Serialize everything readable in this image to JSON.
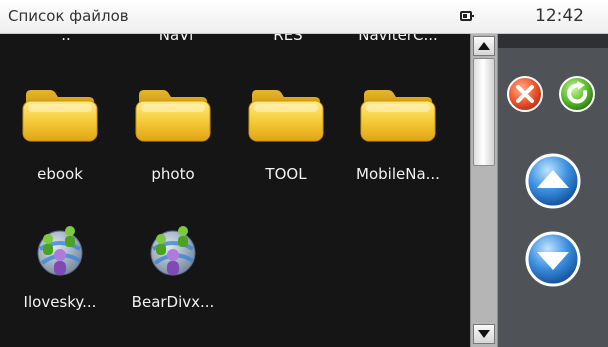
{
  "titlebar": {
    "title": "Список файлов",
    "battery_icon": "battery-icon",
    "time": "12:42"
  },
  "files": {
    "partial_row": [
      "..",
      "NaVi",
      "RES",
      "NaviterC..."
    ],
    "items": [
      {
        "label": "ebook",
        "icon": "folder-icon"
      },
      {
        "label": "photo",
        "icon": "folder-icon"
      },
      {
        "label": "TOOL",
        "icon": "folder-icon"
      },
      {
        "label": "MobileNa...",
        "icon": "folder-icon"
      },
      {
        "label": "Ilovesky...",
        "icon": "users-globe-icon"
      },
      {
        "label": "BearDivx...",
        "icon": "users-globe-icon"
      }
    ]
  },
  "scrollbar": {
    "up_icon": "scroll-up-arrow-icon",
    "down_icon": "scroll-down-arrow-icon"
  },
  "sidepanel": {
    "buttons": [
      {
        "name": "close-button",
        "icon": "close-icon",
        "color": "#ea5a3a"
      },
      {
        "name": "refresh-button",
        "icon": "refresh-icon",
        "color": "#52b52a"
      },
      {
        "name": "page-up-button",
        "icon": "up-arrow-icon",
        "color": "#2f7fd6"
      },
      {
        "name": "page-down-button",
        "icon": "down-arrow-icon",
        "color": "#2f7fd6"
      }
    ]
  },
  "colors": {
    "file_background": "#151515",
    "panel_background": "#4f5257",
    "folder_yellow": "#f2c12e",
    "label_text": "#f2f2f2"
  }
}
